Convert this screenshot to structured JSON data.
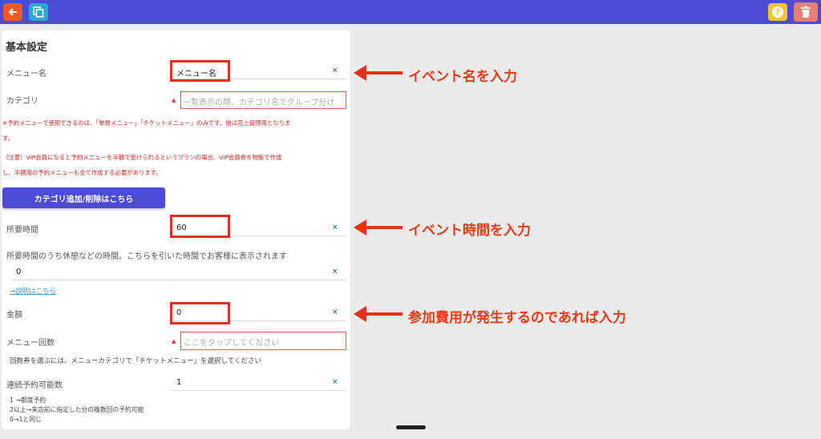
{
  "colors": {
    "accent": "#4b4bd6",
    "annotation": "#e5301c",
    "warning_text": "#e01f1f"
  },
  "toolbar": {
    "back_icon": "back-arrow-icon",
    "copy_icon": "copy-icon",
    "help_icon": "help-icon",
    "trash_icon": "trash-icon"
  },
  "section_title": "基本設定",
  "fields": {
    "menu_name": {
      "label": "メニュー名",
      "value": "メニュー名"
    },
    "category": {
      "label": "カテゴリ",
      "placeholder": "一覧表示の際、カテゴリ名でグループ分け"
    },
    "duration": {
      "label": "所要時間",
      "value": "60"
    },
    "break_time": {
      "label": "所要時間のうち休憩などの時間。こちらを引いた時間でお客様に表示されます",
      "value": "0"
    },
    "price": {
      "label": "金額",
      "value": "0"
    },
    "menu_count": {
      "label": "メニュー回数",
      "placeholder": "ここをタップしてください"
    },
    "consecutive": {
      "label": "連続予約可能数",
      "value": "1"
    }
  },
  "notes": {
    "reserve_line1": "※予約メニューで使用できるのは、「単発メニュー」「チケットメニュー」のみです。他は売上管理用となりま",
    "reserve_line2": "す。",
    "vip_line1": "（注意）VIP会員になると予約メニューを半額で受けられるというプランの場合、VIP会員券を物販で作成",
    "vip_line2": "し、半額用の予約メニューも全て作成する必要があります。",
    "ticket_hint": "回数券を選ぶには、メニューカテゴリで「チケットメニュー」を選択してください",
    "consecutive_help": "1 →都度予約\n2以上→来店前に指定した分の複数回の予約可能\n0→1と同じ"
  },
  "category_button": "カテゴリ追加/削除はこちら",
  "explain_link": "→説明はこちら",
  "clear_symbol": "×",
  "warn_symbol": "▲",
  "annotations": {
    "event_name": "イベント名を入力",
    "event_time": "イベント時間を入力",
    "fee": "参加費用が発生するのであれば入力"
  }
}
